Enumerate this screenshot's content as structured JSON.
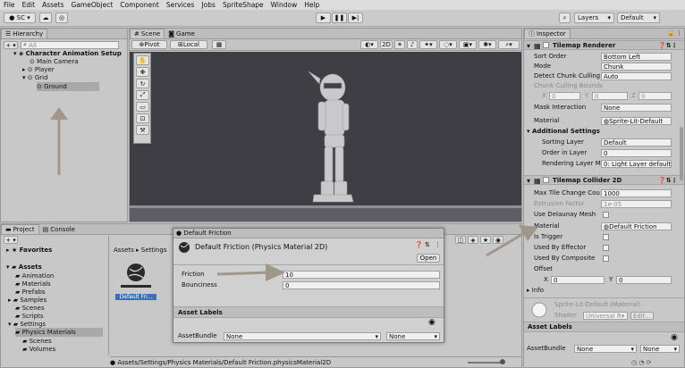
{
  "menu": [
    "File",
    "Edit",
    "Assets",
    "GameObject",
    "Component",
    "Services",
    "Jobs",
    "SpriteShape",
    "Window",
    "Help"
  ],
  "toolbar": {
    "account": "SC",
    "layers": "Layers",
    "layout": "Default"
  },
  "hierarchy": {
    "tab": "Hierarchy",
    "search_placeholder": "All",
    "scene": "Character Animation Setup",
    "items": [
      "Main Camera",
      "Player",
      "Grid",
      "Ground"
    ]
  },
  "scene": {
    "tabs": [
      "Scene",
      "Game"
    ],
    "pivot": "Pivot",
    "local": "Local"
  },
  "project": {
    "tabs": [
      "Project",
      "Console"
    ],
    "favorites": "Favorites",
    "assets": "Assets",
    "folders": [
      "Animation",
      "Materials",
      "Prefabs",
      "Samples",
      "Scenes",
      "Scripts",
      "Settings",
      "Physics Materials",
      "Scenes",
      "Volumes"
    ],
    "breadcrumb": [
      "Assets",
      "Settings"
    ],
    "asset_label": "Default Fri...",
    "path": "Assets/Settings/Physics Materials/Default Friction.physicsMaterial2D"
  },
  "popup": {
    "title": "Default Friction",
    "header": "Default Friction (Physics Material 2D)",
    "open": "Open",
    "friction_label": "Friction",
    "friction_value": "10",
    "bounciness_label": "Bounciness",
    "bounciness_value": "0",
    "asset_labels": "Asset Labels",
    "bundle_label": "AssetBundle",
    "bundle_value": "None",
    "bundle_variant": "None"
  },
  "inspector": {
    "tab": "Inspector",
    "tilemap_renderer": {
      "title": "Tilemap Renderer",
      "sort_order_label": "Sort Order",
      "sort_order": "Bottom Left",
      "mode_label": "Mode",
      "mode": "Chunk",
      "detect_label": "Detect Chunk Culling",
      "detect": "Auto",
      "bounds_label": "Chunk Culling Bounds",
      "bx": "X",
      "bx_val": "0",
      "by": "Y",
      "by_val": "0",
      "bz": "Z",
      "bz_val": "0",
      "mask_label": "Mask Interaction",
      "mask": "None",
      "material_label": "Material",
      "material": "Sprite-Lit-Default",
      "additional": "Additional Settings",
      "sorting_layer_label": "Sorting Layer",
      "sorting_layer": "Default",
      "order_label": "Order in Layer",
      "order": "0",
      "rendering_label": "Rendering Layer M",
      "rendering": "0: Light Layer default"
    },
    "tilemap_collider": {
      "title": "Tilemap Collider 2D",
      "max_tile_label": "Max Tile Change Cou",
      "max_tile": "1000",
      "extrusion_label": "Extrusion Factor",
      "extrusion": "1e-05",
      "delaunay_label": "Use Delaunay Mesh",
      "material_label": "Material",
      "material": "Default Friction",
      "trigger_label": "Is Trigger",
      "effector_label": "Used By Effector",
      "composite_label": "Used By Composite",
      "offset_label": "Offset",
      "ox": "X",
      "ox_val": "0",
      "oy": "Y",
      "oy_val": "0",
      "info": "Info"
    },
    "material_preview": {
      "name": "Sprite-Lit-Default (Material)",
      "shader_label": "Shader",
      "shader": "Universal R▾",
      "edit": "Edit..."
    },
    "asset_labels": "Asset Labels",
    "bundle_label": "AssetBundle",
    "bundle_value": "None",
    "bundle_variant": "None"
  },
  "colors": {
    "scene_bg": "#3e3e44",
    "arrow": "#a0968a"
  }
}
